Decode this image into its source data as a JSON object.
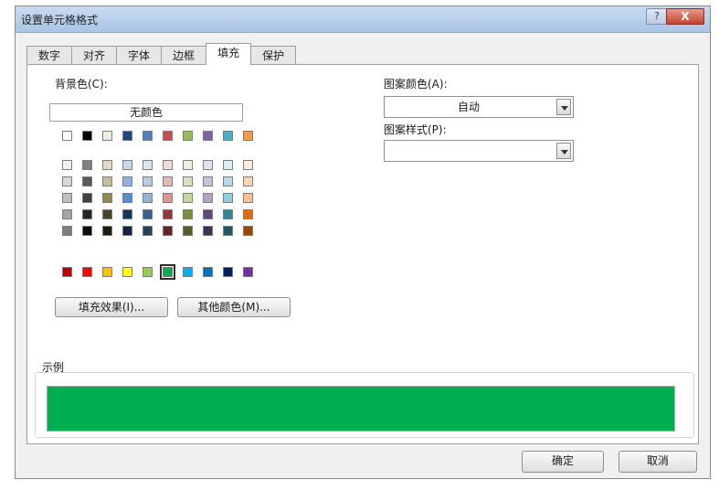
{
  "window": {
    "title": "设置单元格格式",
    "help": "?",
    "close": "X"
  },
  "tabs": [
    {
      "label": "数字"
    },
    {
      "label": "对齐"
    },
    {
      "label": "字体"
    },
    {
      "label": "边框"
    },
    {
      "label": "填充",
      "active": true
    },
    {
      "label": "保护"
    }
  ],
  "fill": {
    "background_color_label": "背景色(C):",
    "no_color_label": "无颜色",
    "pattern_color_label": "图案颜色(A):",
    "pattern_color_value": "自动",
    "pattern_style_label": "图案样式(P):",
    "pattern_style_value": "",
    "fill_effects_button": "填充效果(I)...",
    "more_colors_button": "其他颜色(M)...",
    "sample_label": "示例",
    "sample_color": "#00b050"
  },
  "palette": {
    "theme_top_row": [
      "#ffffff",
      "#000000",
      "#eeece1",
      "#1f497d",
      "#4f81bd",
      "#c0504d",
      "#9bbb59",
      "#8064a2",
      "#4bacc6",
      "#f79646"
    ],
    "theme_tints": [
      [
        "#f2f2f2",
        "#7f7f7f",
        "#ddd9c3",
        "#c6d9f0",
        "#dbe5f1",
        "#f2dcdb",
        "#ebf1dd",
        "#e5e0ec",
        "#dbeef3",
        "#fdeada"
      ],
      [
        "#d8d8d8",
        "#595959",
        "#c4bd97",
        "#8db3e2",
        "#b8cce4",
        "#e5b9b7",
        "#d7e3bc",
        "#ccc1d9",
        "#b7dde8",
        "#fbd5b5"
      ],
      [
        "#bfbfbf",
        "#3f3f3f",
        "#938953",
        "#548dd4",
        "#95b3d7",
        "#d99694",
        "#c3d69b",
        "#b2a2c7",
        "#92cddc",
        "#fac08f"
      ],
      [
        "#a5a5a5",
        "#262626",
        "#494429",
        "#17365d",
        "#366092",
        "#953734",
        "#76923c",
        "#5f497a",
        "#31859b",
        "#e36c09"
      ],
      [
        "#7f7f7f",
        "#0c0c0c",
        "#1d1b10",
        "#0f243e",
        "#244061",
        "#632423",
        "#4f6128",
        "#3f3151",
        "#205867",
        "#974806"
      ]
    ],
    "standard": [
      "#c00000",
      "#ff0000",
      "#ffc000",
      "#ffff00",
      "#92d050",
      "#00b050",
      "#00b0f0",
      "#0070c0",
      "#002060",
      "#7030a0"
    ],
    "selected_standard_index": 5
  },
  "footer": {
    "ok": "确定",
    "cancel": "取消"
  }
}
